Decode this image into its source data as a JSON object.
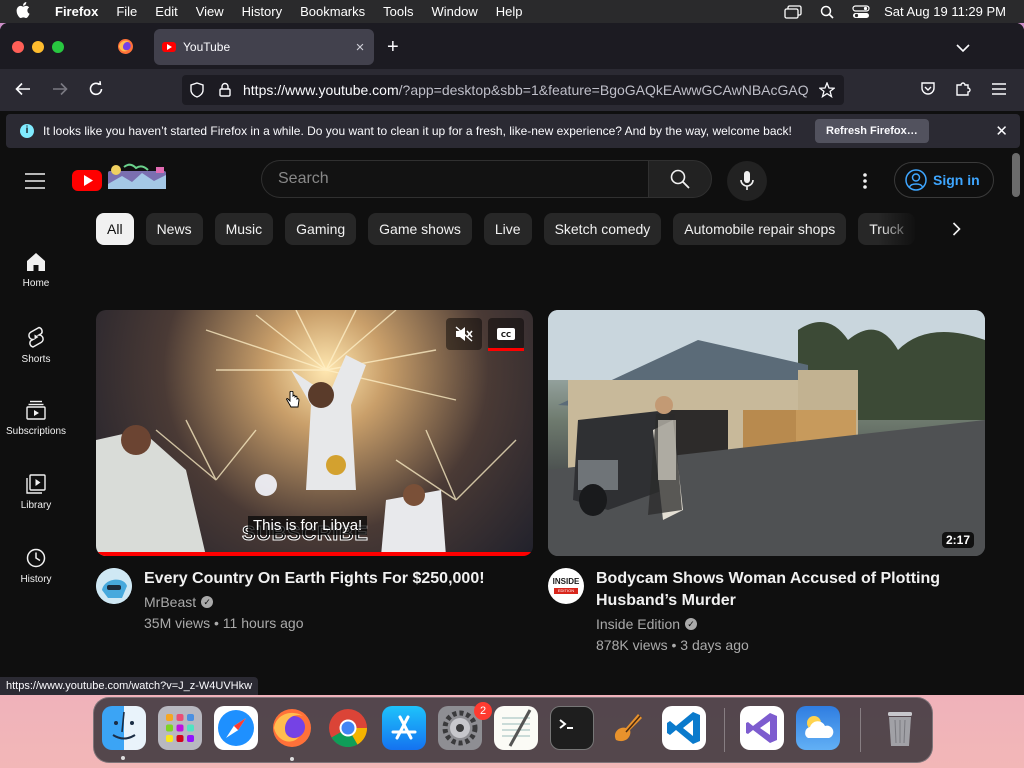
{
  "menubar": {
    "app_name": "Firefox",
    "items": [
      "File",
      "Edit",
      "View",
      "History",
      "Bookmarks",
      "Tools",
      "Window",
      "Help"
    ],
    "clock": "Sat Aug 19  11:29 PM"
  },
  "browser": {
    "tab_title": "YouTube",
    "url_host": "https://www.youtube.com",
    "url_rest": "/?app=desktop&sbb=1&feature=BgoGAQkEAwwGCAwNBAcGAQ",
    "infobar_message": "It looks like you haven’t started Firefox in a while. Do you want to clean it up for a fresh, like-new experience? And by the way, welcome back!",
    "infobar_button": "Refresh Firefox…",
    "status_link": "https://www.youtube.com/watch?v=J_z-W4UVHkw"
  },
  "youtube": {
    "search_placeholder": "Search",
    "sign_in_label": "Sign in",
    "chips": [
      "All",
      "News",
      "Music",
      "Gaming",
      "Game shows",
      "Live",
      "Sketch comedy",
      "Automobile repair shops",
      "Truck"
    ],
    "sidebar": [
      {
        "label": "Home",
        "icon": "home-icon"
      },
      {
        "label": "Shorts",
        "icon": "shorts-icon"
      },
      {
        "label": "Subscriptions",
        "icon": "subscriptions-icon"
      },
      {
        "label": "Library",
        "icon": "library-icon"
      },
      {
        "label": "History",
        "icon": "history-icon"
      }
    ],
    "videos": [
      {
        "title": "Every Country On Earth Fights For $250,000!",
        "channel": "MrBeast",
        "meta": "35M views • 11 hours ago",
        "caption": "This is for Libya!",
        "overlay_text": "SUBSCRIBE",
        "progress": 1.0
      },
      {
        "title_line1": "Bodycam Shows Woman Accused of Plotting",
        "title_line2": "Husband’s Murder",
        "channel": "Inside Edition",
        "meta": "878K views • 3 days ago",
        "duration": "2:17",
        "avatar_line1": "INSIDE",
        "avatar_line2": "EDITION"
      }
    ]
  },
  "dock": {
    "badge_count": "2",
    "apps": [
      "Finder",
      "Launchpad",
      "Safari",
      "Firefox",
      "Chrome",
      "App Store",
      "System Settings",
      "TextEdit",
      "Terminal",
      "GarageBand",
      "Visual Studio Code",
      "Visual Studio",
      "Weather",
      "Trash"
    ]
  },
  "colors": {
    "youtube_bg": "#0f0f0f",
    "youtube_red": "#ff0000",
    "sign_in_blue": "#3ea6ff",
    "firefox_toolbar": "#2b2a33"
  }
}
